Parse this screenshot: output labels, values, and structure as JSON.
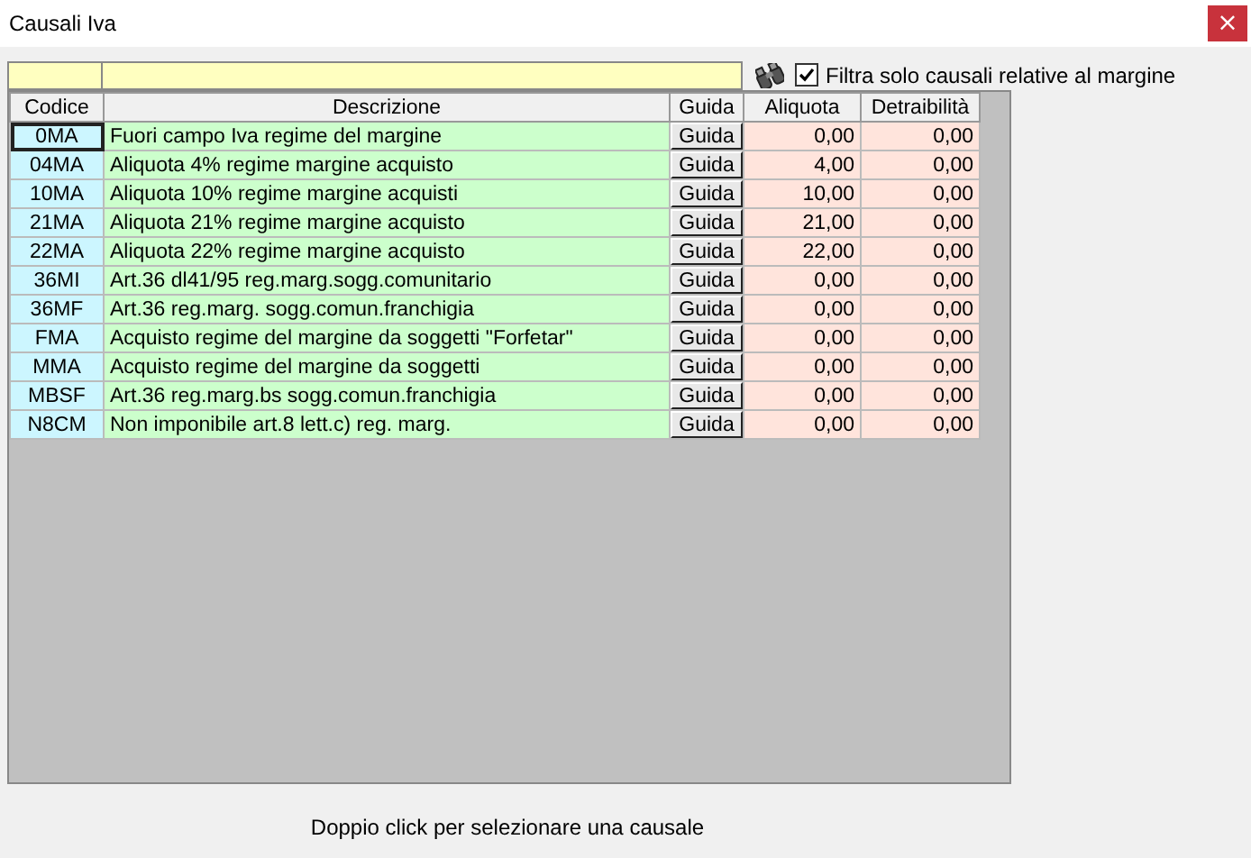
{
  "window": {
    "title": "Causali Iva",
    "close": "×"
  },
  "filter": {
    "checkbox": {
      "label": "Filtra solo causali relative al margine",
      "checked": true
    }
  },
  "table": {
    "columns": [
      "Codice",
      "Descrizione",
      "Guida",
      "Aliquota",
      "Detraibilità"
    ],
    "rows": [
      {
        "codice": "0MA",
        "descrizione": "Fuori campo Iva regime del margine",
        "guida": "Guida",
        "aliquota": "0,00",
        "detraibilita": "0,00",
        "selected": true
      },
      {
        "codice": "04MA",
        "descrizione": "Aliquota 4% regime margine acquisto",
        "guida": "Guida",
        "aliquota": "4,00",
        "detraibilita": "0,00",
        "selected": false
      },
      {
        "codice": "10MA",
        "descrizione": "Aliquota 10% regime margine acquisti",
        "guida": "Guida",
        "aliquota": "10,00",
        "detraibilita": "0,00",
        "selected": false
      },
      {
        "codice": "21MA",
        "descrizione": "Aliquota 21% regime margine acquisto",
        "guida": "Guida",
        "aliquota": "21,00",
        "detraibilita": "0,00",
        "selected": false
      },
      {
        "codice": "22MA",
        "descrizione": "Aliquota 22% regime margine acquisto",
        "guida": "Guida",
        "aliquota": "22,00",
        "detraibilita": "0,00",
        "selected": false
      },
      {
        "codice": "36MI",
        "descrizione": "Art.36 dl41/95 reg.marg.sogg.comunitario",
        "guida": "Guida",
        "aliquota": "0,00",
        "detraibilita": "0,00",
        "selected": false
      },
      {
        "codice": "36MF",
        "descrizione": "Art.36 reg.marg. sogg.comun.franchigia",
        "guida": "Guida",
        "aliquota": "0,00",
        "detraibilita": "0,00",
        "selected": false
      },
      {
        "codice": "FMA",
        "descrizione": "Acquisto regime del margine da soggetti \"Forfetar\"",
        "guida": "Guida",
        "aliquota": "0,00",
        "detraibilita": "0,00",
        "selected": false
      },
      {
        "codice": "MMA",
        "descrizione": "Acquisto regime del margine da soggetti",
        "guida": "Guida",
        "aliquota": "0,00",
        "detraibilita": "0,00",
        "selected": false
      },
      {
        "codice": "MBSF",
        "descrizione": "Art.36 reg.marg.bs sogg.comun.franchigia",
        "guida": "Guida",
        "aliquota": "0,00",
        "detraibilita": "0,00",
        "selected": false
      },
      {
        "codice": "N8CM",
        "descrizione": "Non imponibile art.8 lett.c) reg. marg.",
        "guida": "Guida",
        "aliquota": "0,00",
        "detraibilita": "0,00",
        "selected": false
      }
    ]
  },
  "status_text": "Doppio click per selezionare una causale"
}
